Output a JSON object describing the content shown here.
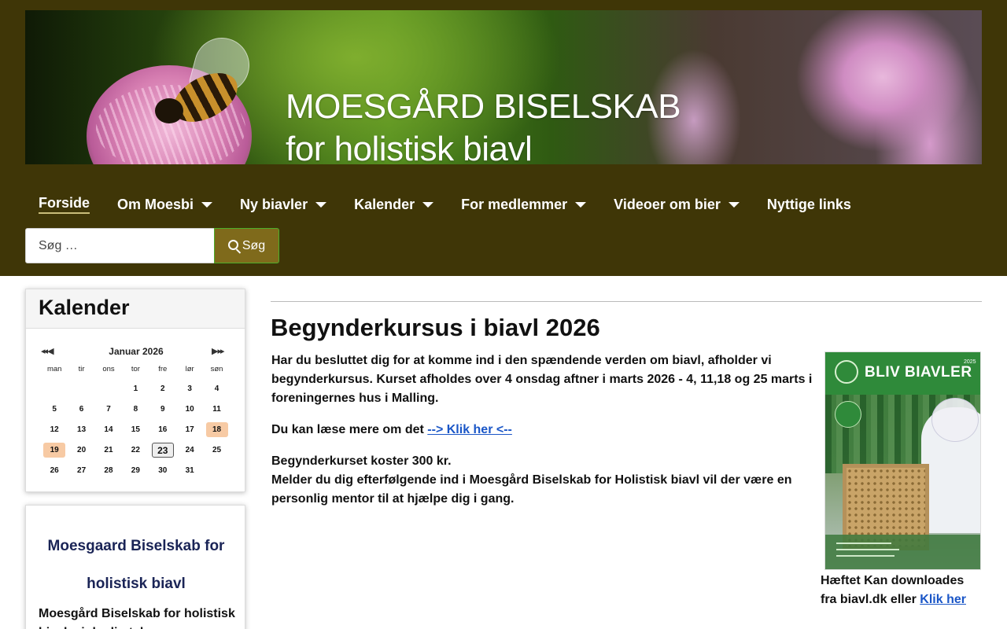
{
  "banner": {
    "title_line1": "MOESGÅRD BISELSKAB",
    "title_line2": "for holistisk biavl"
  },
  "nav": {
    "items": [
      {
        "label": "Forside",
        "active": true,
        "has_dropdown": false
      },
      {
        "label": "Om Moesbi",
        "has_dropdown": true
      },
      {
        "label": "Ny biavler",
        "has_dropdown": true
      },
      {
        "label": "Kalender",
        "has_dropdown": true
      },
      {
        "label": "For medlemmer",
        "has_dropdown": true
      },
      {
        "label": "Videoer om bier",
        "has_dropdown": true
      },
      {
        "label": "Nyttige links",
        "has_dropdown": false
      }
    ]
  },
  "search": {
    "placeholder": "Søg …",
    "button_label": "Søg"
  },
  "calendar": {
    "heading": "Kalender",
    "prev_symbol": "◂◂ ◀",
    "next_symbol": "▶ ▸▸",
    "month": "Januar 2026",
    "weekdays": [
      "man",
      "tir",
      "ons",
      "tor",
      "fre",
      "lør",
      "søn"
    ],
    "weeks": [
      [
        "",
        "",
        "",
        "1",
        "2",
        "3",
        "4"
      ],
      [
        "5",
        "6",
        "7",
        "8",
        "9",
        "10",
        "11"
      ],
      [
        "12",
        "13",
        "14",
        "15",
        "16",
        "17",
        "18"
      ],
      [
        "19",
        "20",
        "21",
        "22",
        "23",
        "24",
        "25"
      ],
      [
        "26",
        "27",
        "28",
        "29",
        "30",
        "31",
        ""
      ]
    ],
    "event_days": [
      "18",
      "19"
    ],
    "today": "23"
  },
  "info_card": {
    "title_line1": "Moesgaard Biselskab for",
    "title_line2": "holistisk biavl",
    "body": "Moesgård Biselskab for holistisk biavl – i daglig tale"
  },
  "main": {
    "title": "Begynderkursus i biavl 2026",
    "intro": "Har du besluttet dig for at komme ind i den spændende verden om biavl, afholder vi begynderkursus. Kurset afholdes over 4 onsdag aftner i marts 2026 - 4, 11,18 og 25 marts i foreningernes hus i Malling.",
    "read_more_prefix": "Du kan læse mere om det ",
    "read_more_link": "--> Klik her <--",
    "price": "Begynderkurset koster 300 kr.",
    "mentor": "Melder du dig efterfølgende ind i Moesgård Biselskab for Holistisk biavl vil der være en personlig mentor til at hjælpe dig i gang."
  },
  "poster": {
    "title": "BLIV BIAVLER",
    "year": "2025"
  },
  "caption": {
    "text": "Hæftet Kan downloades fra biavl.dk eller ",
    "link": "Klik her"
  }
}
